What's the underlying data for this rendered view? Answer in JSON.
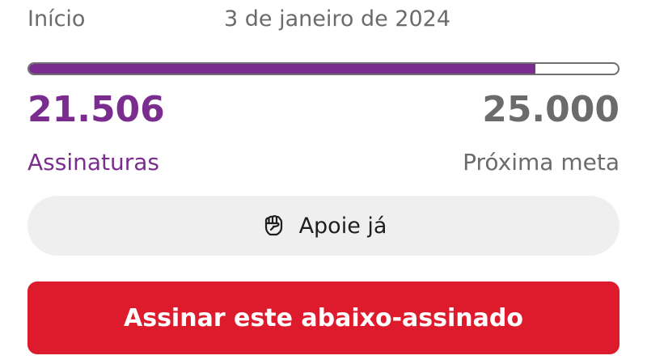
{
  "header": {
    "start_label": "Início",
    "date": "3 de janeiro de 2024"
  },
  "progress": {
    "signatures_count": "21.506",
    "signatures_label": "Assinaturas",
    "goal_value": "25.000",
    "goal_label": "Próxima meta",
    "fraction": 0.86
  },
  "actions": {
    "support_label": "Apoie já",
    "support_icon": "raised-fist-icon",
    "sign_label": "Assinar este abaixo-assinado"
  },
  "colors": {
    "accent_purple": "#7a2d8f",
    "cta_red": "#de1b2c",
    "muted_gray": "#6b6b6b"
  }
}
